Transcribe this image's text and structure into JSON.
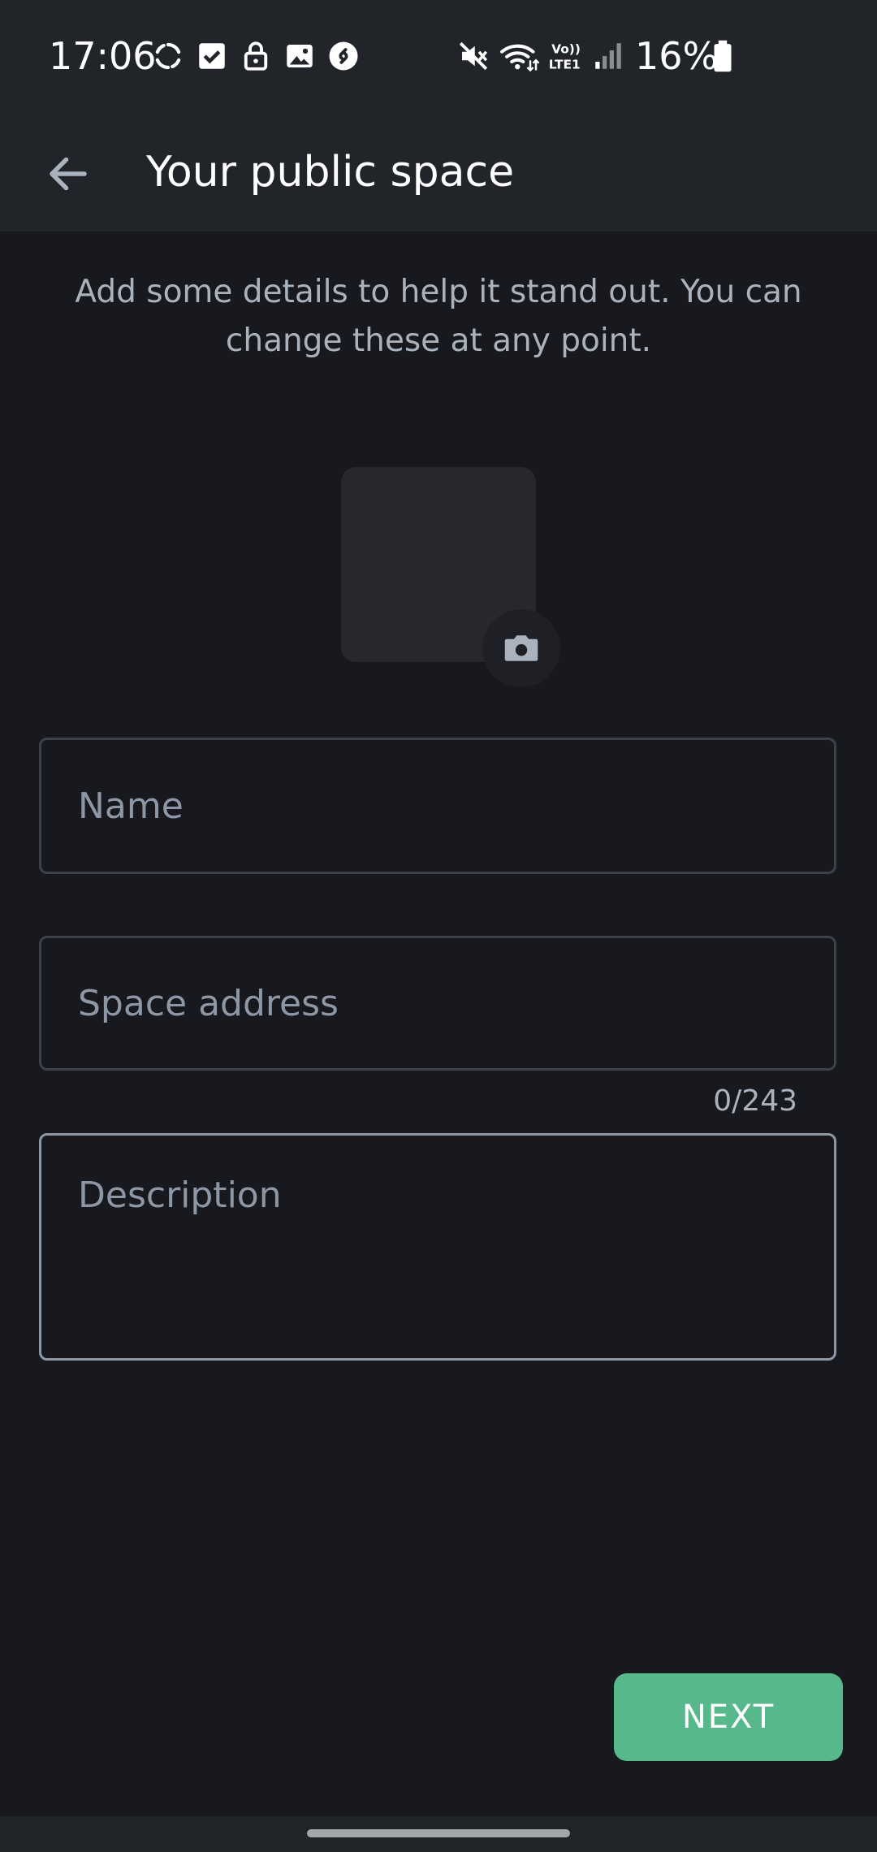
{
  "status_bar": {
    "time": "17:06",
    "battery_percent": "16%",
    "icons": [
      "sync-icon",
      "checkbox-icon",
      "lock-icon",
      "gallery-icon",
      "shazam-icon",
      "mute-icon",
      "wifi-icon",
      "volte-icon",
      "signal-icon",
      "battery-icon"
    ]
  },
  "app_bar": {
    "title": "Your public space",
    "back_icon": "arrow-back-icon"
  },
  "intro_text": "Add some details to help it stand out. You can change these at any point.",
  "avatar": {
    "camera_icon": "camera-icon"
  },
  "form": {
    "name_placeholder": "Name",
    "name_value": "",
    "address_placeholder": "Space address",
    "address_value": "",
    "description_placeholder": "Description",
    "description_value": "",
    "counter": "0/243"
  },
  "next_label": "NEXT",
  "colors": {
    "background": "#17191e",
    "bar": "#212429",
    "accent": "#57b98b"
  }
}
